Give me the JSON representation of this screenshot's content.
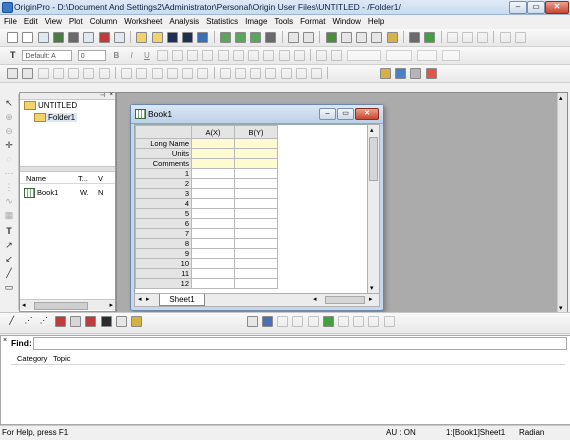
{
  "window": {
    "title": "OriginPro  -  D:\\Document And Settings2\\Administrator\\Personal\\Origin User Files\\UNTITLED - /Folder1/"
  },
  "window_controls": {
    "minimize": "–",
    "maximize": "▭",
    "close": "✕"
  },
  "menu": [
    "File",
    "Edit",
    "View",
    "Plot",
    "Column",
    "Worksheet",
    "Analysis",
    "Statistics",
    "Image",
    "Tools",
    "Format",
    "Window",
    "Help"
  ],
  "format_toolbar": {
    "font_value": "Default: A",
    "size_value": "0",
    "bold": "B",
    "italic": "I",
    "underline": "U"
  },
  "project_explorer": {
    "root": "UNTITLED",
    "folder": "Folder1",
    "columns": [
      "Name",
      "T...",
      "V"
    ],
    "items": [
      {
        "name": "Book1",
        "type": "W.",
        "v": "N"
      }
    ]
  },
  "workbook": {
    "title": "Book1",
    "columns": [
      "A(X)",
      "B(Y)"
    ],
    "header_rows": [
      "Long Name",
      "Units",
      "Comments"
    ],
    "rows": [
      "1",
      "2",
      "3",
      "4",
      "5",
      "6",
      "7",
      "8",
      "9",
      "10",
      "11",
      "12"
    ],
    "sheet_tab": "Sheet1"
  },
  "find_panel": {
    "label": "Find:",
    "value": "",
    "columns": [
      "Category",
      "Topic"
    ]
  },
  "status": {
    "help": "For Help, press F1",
    "au": "AU : ON",
    "sheet": "1:[Book1]Sheet1",
    "angle": "Radian"
  }
}
